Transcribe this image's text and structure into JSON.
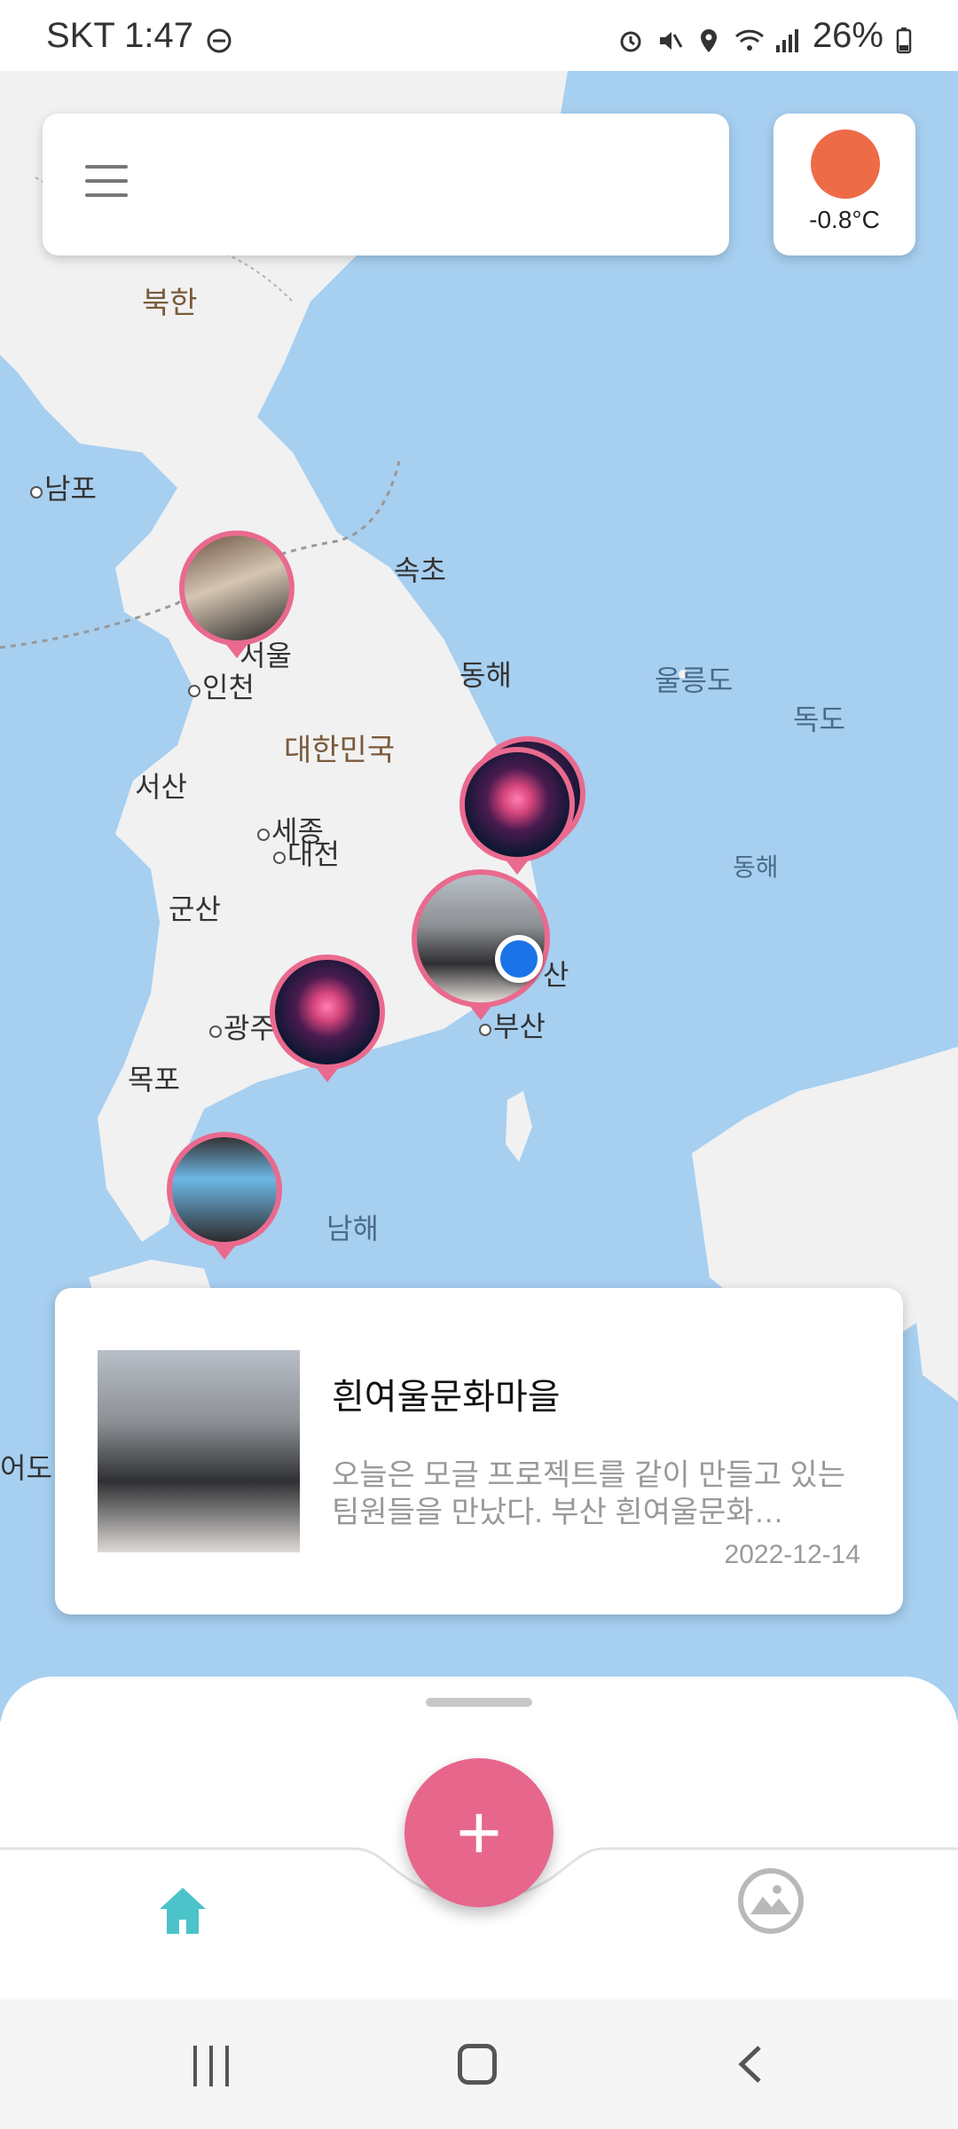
{
  "status_bar": {
    "carrier_time": "SKT 1:47",
    "battery": "26%"
  },
  "weather": {
    "temperature": "-0.8°C"
  },
  "map_labels": [
    {
      "text": "북한"
    },
    {
      "text": "남포"
    },
    {
      "text": "속초"
    },
    {
      "text": "서울"
    },
    {
      "text": "인천"
    },
    {
      "text": "동해"
    },
    {
      "text": "울릉도"
    },
    {
      "text": "독도"
    },
    {
      "text": "대한민국"
    },
    {
      "text": "서산"
    },
    {
      "text": "세종"
    },
    {
      "text": "대전"
    },
    {
      "text": "동해"
    },
    {
      "text": "군산"
    },
    {
      "text": "산"
    },
    {
      "text": "광주"
    },
    {
      "text": "부산"
    },
    {
      "text": "목포"
    },
    {
      "text": "남해"
    },
    {
      "text": "어도"
    }
  ],
  "card": {
    "title": "흰여울문화마을",
    "text": "오늘은 모글 프로젝트를 같이 만들고 있는 팀원들을 만났다. 부산 흰여울문화…",
    "date": "2022-12-14"
  },
  "fab": {
    "label": "+"
  },
  "colors": {
    "accent_pink": "#e7668c",
    "pin_border": "#e96a8e",
    "sun": "#ed6b47",
    "home_icon": "#4cc3c9",
    "location_dot": "#1a73e8"
  },
  "icons": [
    "menu-icon",
    "weather-sun-icon",
    "home-icon",
    "gallery-icon",
    "add-icon",
    "location-dot-icon",
    "recents-icon",
    "home-nav-icon",
    "back-icon"
  ]
}
